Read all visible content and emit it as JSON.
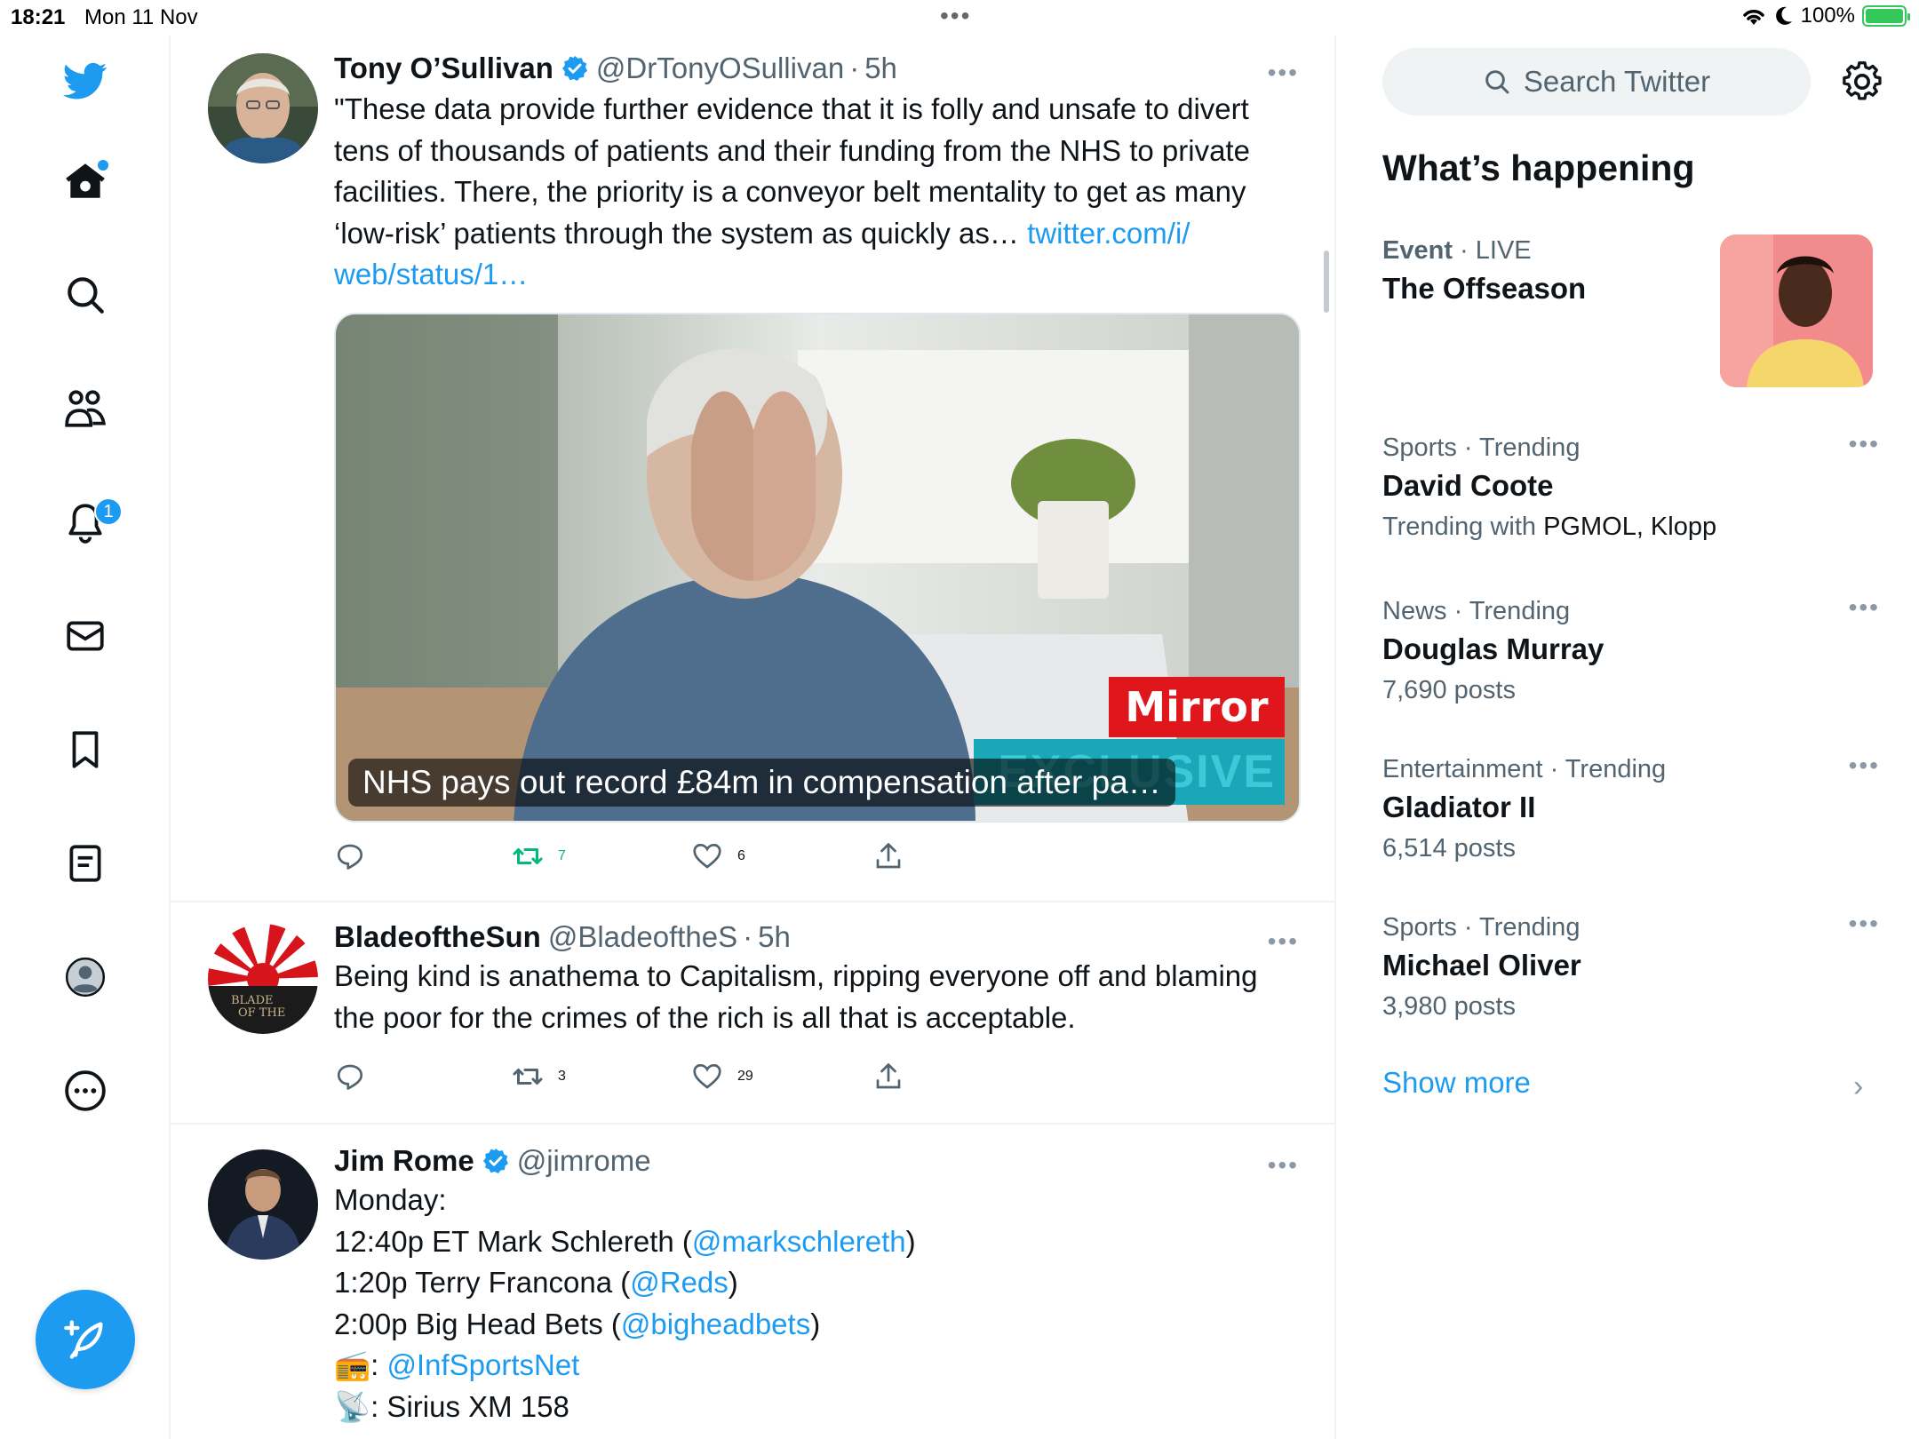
{
  "status_bar": {
    "time": "18:21",
    "date": "Mon 11 Nov",
    "battery": "100%"
  },
  "nav": {
    "notifications_badge": "1",
    "icons": [
      "twitter-logo-icon",
      "home-icon",
      "search-icon",
      "communities-icon",
      "bell-icon",
      "mail-icon",
      "bookmark-icon",
      "lists-icon",
      "profile-icon",
      "more-circle-icon",
      "compose-icon"
    ]
  },
  "tweets": [
    {
      "name": "Tony O’Sullivan",
      "handle": "@DrTonyOSullivan",
      "sep": "·",
      "time": "5h",
      "text_lines": [
        "\"These data provide further evidence that it is folly and unsafe to divert",
        "tens of thousands of patients and their funding from the NHS to private",
        "facilities. There, the priority is a conveyor belt mentality to get as many",
        "‘low-risk’ patients through the system as quickly as… "
      ],
      "link_part1": "twitter.com/i/",
      "link_part2": "web/status/1…",
      "media_caption": "NHS pays out record £84m in compensation after pa…",
      "media_brand": "Mirror",
      "media_tag": "EXCLUSIVE",
      "retweets": "7",
      "likes": "6"
    },
    {
      "name": "BladeoftheSun",
      "handle": "@BladeoftheS",
      "sep": "·",
      "time": "5h",
      "line1": "Being kind is anathema to Capitalism, ripping everyone off and blaming",
      "line2": "the poor for the crimes of the rich is all that is acceptable.",
      "avatar_text_1": "BLADE",
      "avatar_text_2": "OF THE",
      "retweets": "3",
      "likes": "29"
    },
    {
      "name": "Jim Rome",
      "handle": "@jimrome",
      "line1": "Monday:",
      "line2_a": "12:40p ET Mark Schlereth (",
      "line2_link": "@markschlereth",
      "line2_b": ")",
      "line3_a": "1:20p Terry Francona (",
      "line3_link": "@Reds",
      "line3_b": ")",
      "line4_a": "2:00p Big Head Bets (",
      "line4_link": "@bigheadbets",
      "line4_b": ")",
      "line5_emoji": "📻",
      "line5_a": ": ",
      "line5_link": "@InfSportsNet",
      "line6_emoji": "📡",
      "line6_a": ": Sirius XM 158"
    }
  ],
  "sidebar": {
    "search_placeholder": "Search Twitter",
    "section_title": "What’s happening",
    "trends": [
      {
        "category": "Event",
        "sep": " · ",
        "status": "LIVE",
        "title": "The Offseason"
      },
      {
        "category": "Sports · Trending",
        "title": "David Coote",
        "sub_prefix": "Trending with ",
        "sub_strong": "PGMOL, Klopp"
      },
      {
        "category": "News · Trending",
        "title": "Douglas Murray",
        "sub": "7,690 posts"
      },
      {
        "category": "Entertainment · Trending",
        "title": "Gladiator II",
        "sub": "6,514 posts"
      },
      {
        "category": "Sports · Trending",
        "title": "Michael Oliver",
        "sub": "3,980 posts"
      }
    ],
    "show_more": "Show more"
  },
  "colors": {
    "accent": "#1d9bf0",
    "retweet": "#00ba7c",
    "secondary_text": "#536471",
    "mirror_red": "#e0161d"
  }
}
